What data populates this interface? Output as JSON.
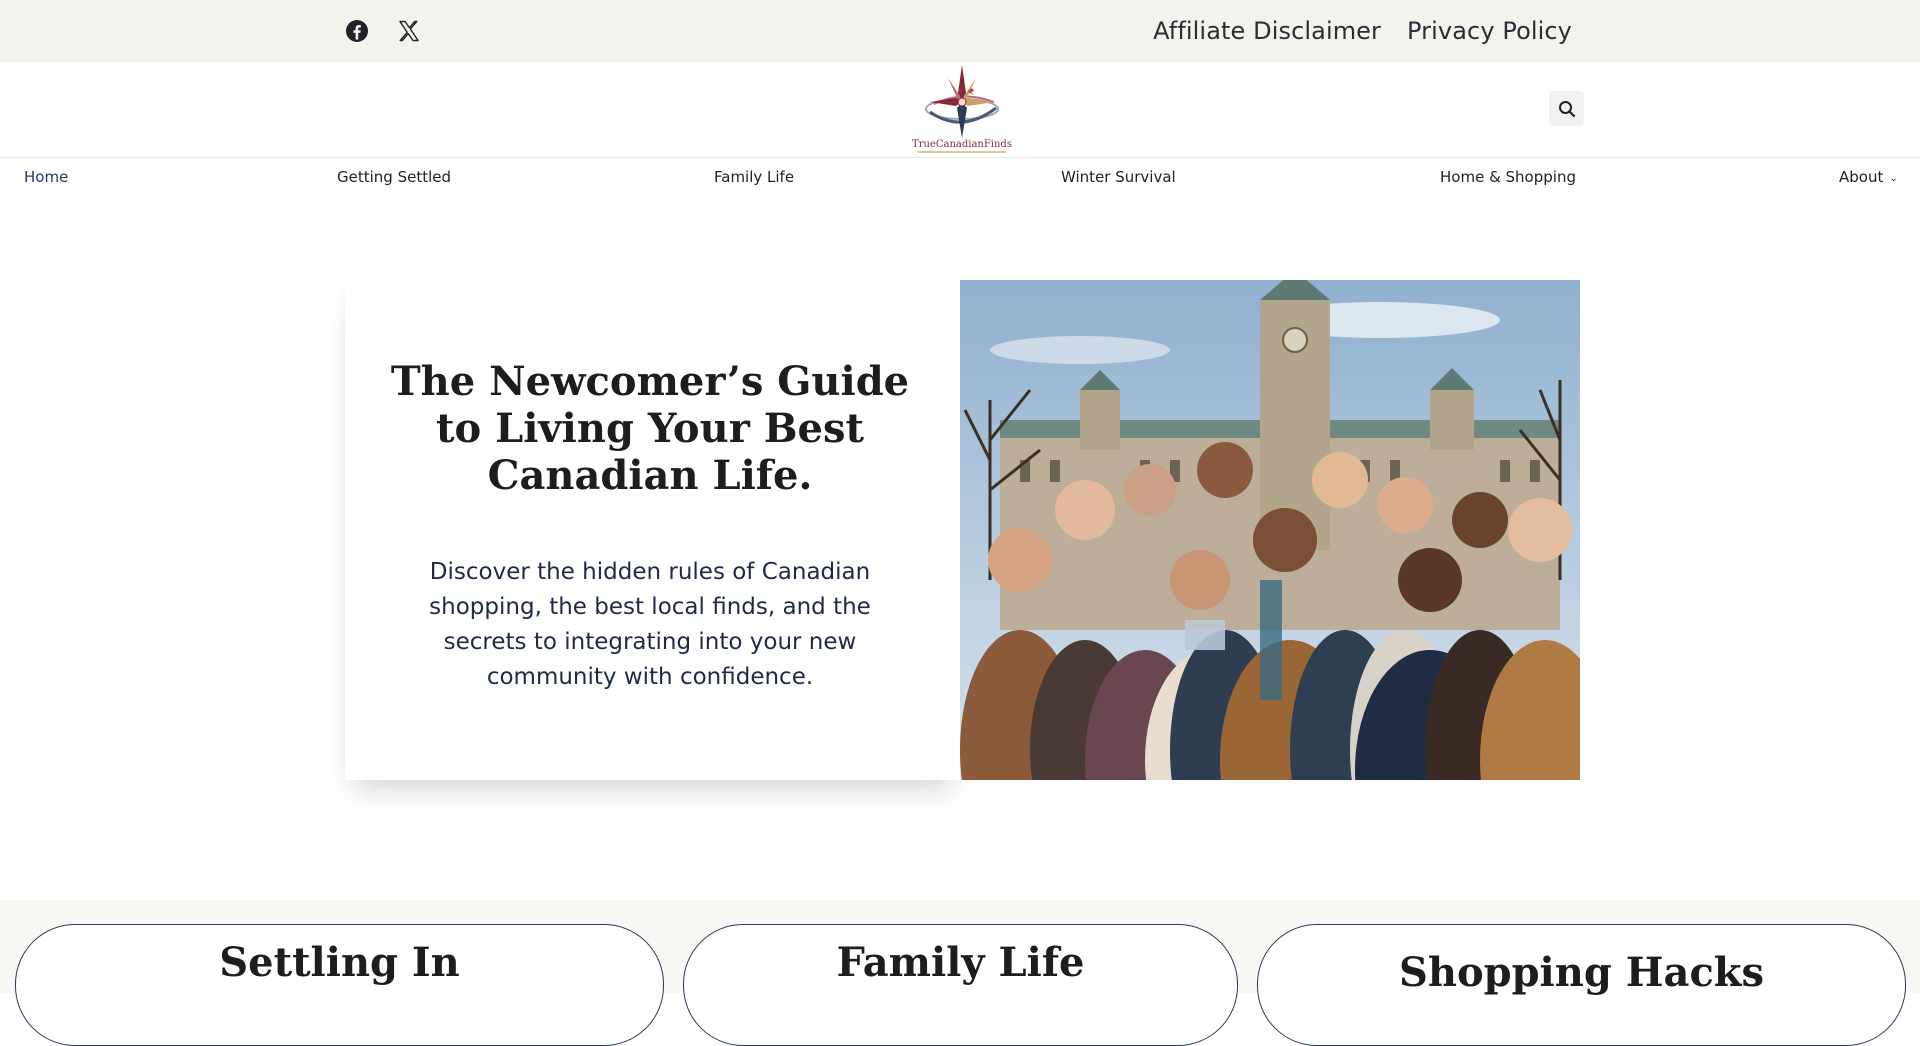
{
  "topbar": {
    "social": [
      {
        "name": "facebook-icon",
        "label": "Facebook"
      },
      {
        "name": "x-icon",
        "label": "X"
      }
    ],
    "links": [
      "Affiliate Disclaimer",
      "Privacy Policy"
    ]
  },
  "header": {
    "logo_text": "TrueCanadianFinds",
    "search_icon": "search-icon"
  },
  "nav": {
    "items": [
      {
        "label": "Home"
      },
      {
        "label": "Getting Settled"
      },
      {
        "label": "Family Life"
      },
      {
        "label": "Winter Survival"
      },
      {
        "label": "Home & Shopping"
      },
      {
        "label": "About"
      }
    ]
  },
  "hero": {
    "title": "The Newcomer’s Guide to Living Your Best Canadian Life.",
    "text": "Discover the hidden rules of Canadian shopping, the best local finds, and the secrets to integrating into your new community with confidence."
  },
  "categories": [
    {
      "title": "Settling In"
    },
    {
      "title": "Family Life"
    },
    {
      "title": "Shopping Hacks"
    }
  ],
  "colors": {
    "topbar_bg": "#f4f2ed",
    "accent_navy": "#1a3a66",
    "card_border": "#2b3a55"
  }
}
